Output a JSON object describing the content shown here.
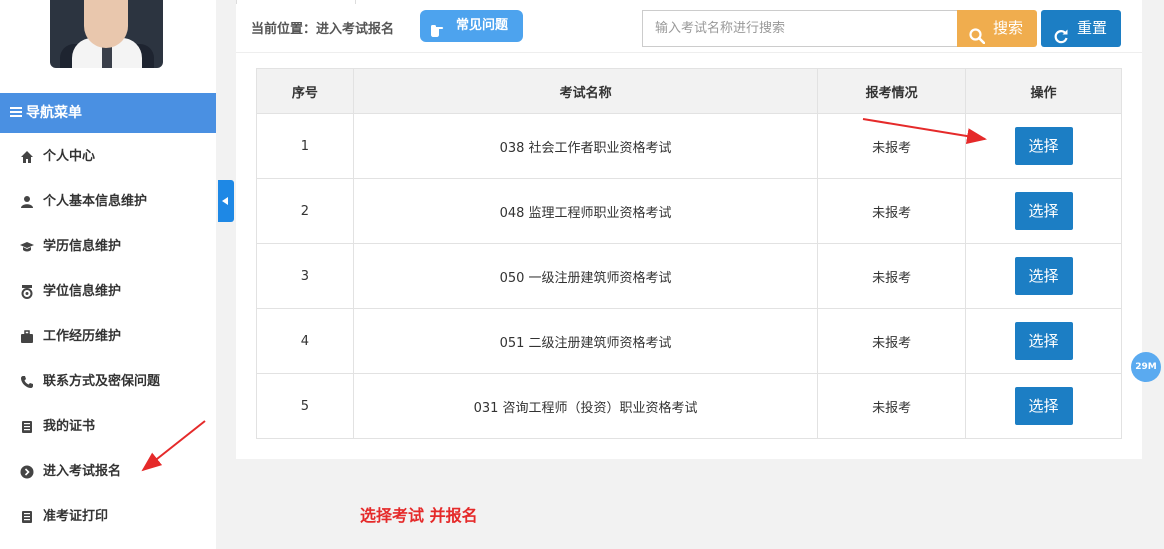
{
  "sidebar": {
    "nav_header": "导航菜单",
    "items": [
      {
        "label": "个人中心",
        "icon": "home-icon"
      },
      {
        "label": "个人基本信息维护",
        "icon": "user-icon"
      },
      {
        "label": "学历信息维护",
        "icon": "graduation-cap-icon"
      },
      {
        "label": "学位信息维护",
        "icon": "medal-icon"
      },
      {
        "label": "工作经历维护",
        "icon": "briefcase-icon"
      },
      {
        "label": "联系方式及密保问题",
        "icon": "phone-icon"
      },
      {
        "label": "我的证书",
        "icon": "book-icon"
      },
      {
        "label": "进入考试报名",
        "icon": "chevron-circle-right-icon"
      },
      {
        "label": "准考证打印",
        "icon": "book-icon"
      }
    ]
  },
  "toolbar": {
    "breadcrumb": "当前位置：进入考试报名",
    "faq_label": "常见问题",
    "search_placeholder": "输入考试名称进行搜索",
    "search_label": "搜索",
    "reset_label": "重置"
  },
  "table": {
    "headers": [
      "序号",
      "考试名称",
      "报考情况",
      "操作"
    ],
    "rows": [
      {
        "no": "1",
        "name": "038 社会工作者职业资格考试",
        "status": "未报考",
        "action": "选择",
        "highlight": true
      },
      {
        "no": "2",
        "name": "048 监理工程师职业资格考试",
        "status": "未报考",
        "action": "选择",
        "highlight": true
      },
      {
        "no": "3",
        "name": "050 一级注册建筑师资格考试",
        "status": "未报考",
        "action": "选择",
        "highlight": true
      },
      {
        "no": "4",
        "name": "051 二级注册建筑师资格考试",
        "status": "未报考",
        "action": "选择",
        "highlight": true
      },
      {
        "no": "5",
        "name": "031 咨询工程师（投资）职业资格考试",
        "status": "未报考",
        "action": "选择",
        "highlight": false
      }
    ]
  },
  "annotation": {
    "caption": "选择考试 并报名"
  },
  "speed_badge": "29M",
  "colors": {
    "nav_header_bg": "#4a90e2",
    "primary_button": "#1c7ec4",
    "search_button": "#f0ad4e",
    "highlight_text": "#e52a2a"
  }
}
